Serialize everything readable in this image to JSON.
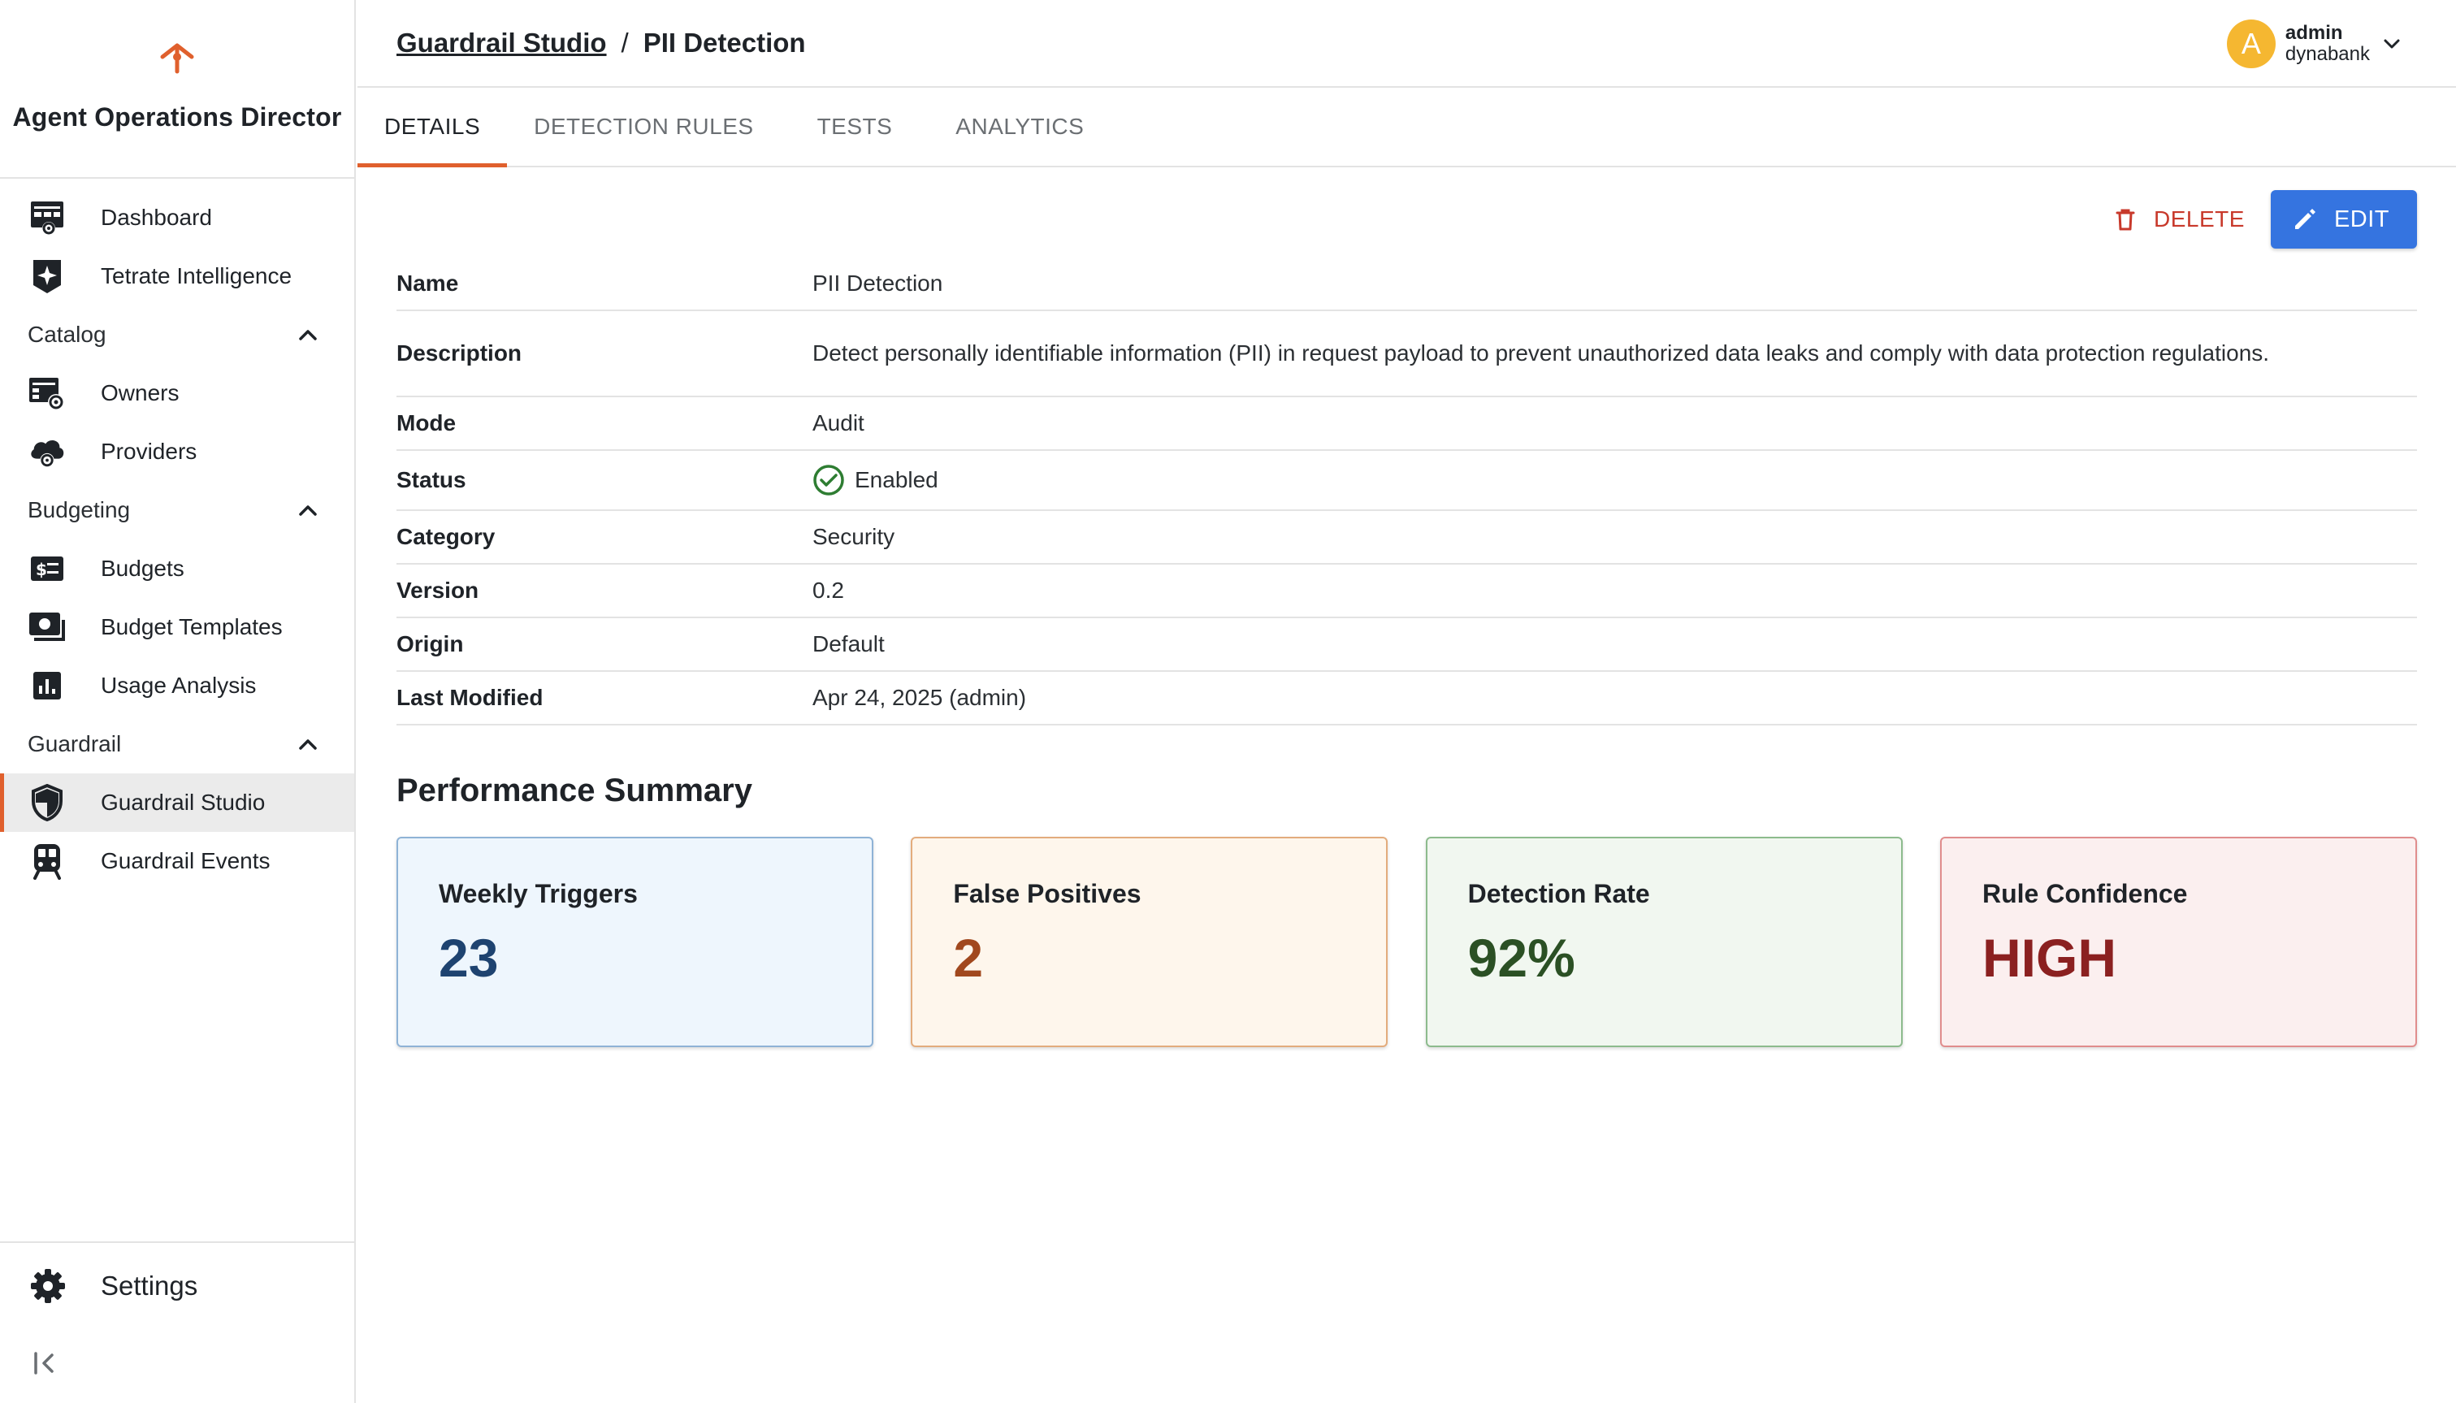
{
  "brand": {
    "name": "Agent Operations Director"
  },
  "sidebar": {
    "items": [
      {
        "label": "Dashboard"
      },
      {
        "label": "Tetrate Intelligence"
      }
    ],
    "sections": [
      {
        "label": "Catalog",
        "items": [
          {
            "label": "Owners"
          },
          {
            "label": "Providers"
          }
        ]
      },
      {
        "label": "Budgeting",
        "items": [
          {
            "label": "Budgets"
          },
          {
            "label": "Budget Templates"
          },
          {
            "label": "Usage Analysis"
          }
        ]
      },
      {
        "label": "Guardrail",
        "items": [
          {
            "label": "Guardrail Studio"
          },
          {
            "label": "Guardrail Events"
          }
        ]
      }
    ],
    "settings_label": "Settings"
  },
  "header": {
    "breadcrumb_parent": "Guardrail Studio",
    "breadcrumb_sep": "/",
    "breadcrumb_current": "PII Detection",
    "user": {
      "initial": "A",
      "name": "admin",
      "org": "dynabank"
    }
  },
  "tabs": [
    {
      "label": "DETAILS"
    },
    {
      "label": "DETECTION RULES"
    },
    {
      "label": "TESTS"
    },
    {
      "label": "ANALYTICS"
    }
  ],
  "actions": {
    "delete_label": "DELETE",
    "edit_label": "EDIT"
  },
  "details": [
    {
      "key": "Name",
      "value": "PII Detection"
    },
    {
      "key": "Description",
      "value": "Detect personally identifiable information (PII) in request payload to prevent unauthorized data leaks and comply with data protection regulations."
    },
    {
      "key": "Mode",
      "value": "Audit"
    },
    {
      "key": "Status",
      "value": "Enabled"
    },
    {
      "key": "Category",
      "value": "Security"
    },
    {
      "key": "Version",
      "value": "0.2"
    },
    {
      "key": "Origin",
      "value": "Default"
    },
    {
      "key": "Last Modified",
      "value": "Apr 24, 2025 (admin)"
    }
  ],
  "performance": {
    "title": "Performance Summary",
    "cards": [
      {
        "title": "Weekly Triggers",
        "value": "23",
        "bg": "#eef6fd",
        "border": "#8fb3d6",
        "color": "#1e4370"
      },
      {
        "title": "False Positives",
        "value": "2",
        "bg": "#fef6ec",
        "border": "#e3ac7d",
        "color": "#a1481e"
      },
      {
        "title": "Detection Rate",
        "value": "92%",
        "bg": "#f1f7f0",
        "border": "#8dbb8d",
        "color": "#2b5024"
      },
      {
        "title": "Rule Confidence",
        "value": "HIGH",
        "bg": "#fbefef",
        "border": "#e08d8d",
        "color": "#8b2020"
      }
    ]
  },
  "colors": {
    "accent": "#e0602d",
    "primary_button": "#3574e0",
    "danger": "#c8392b",
    "success": "#2e7d32"
  }
}
